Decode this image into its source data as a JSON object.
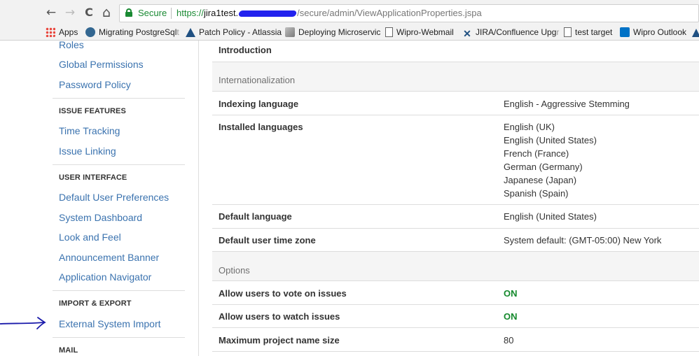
{
  "browser": {
    "nav": {
      "back": "←",
      "forward": "→",
      "reload": "C",
      "home": "⌂"
    },
    "secure_label": "Secure",
    "url_scheme": "https://",
    "url_host": "jira1test.",
    "url_path": "/secure/admin/ViewApplicationProperties.jspa",
    "bookmarks": [
      {
        "label": "Apps",
        "icon": "apps-grid-icon",
        "color": "#e8453c"
      },
      {
        "label": "Migrating PostgreSql",
        "fade": "t",
        "icon": "elephant-icon",
        "color": "#336791"
      },
      {
        "label": "Patch Policy - Atlassia",
        "icon": "atlassian-icon",
        "color": "#205081"
      },
      {
        "label": "Deploying Microservic",
        "icon": "deploy-icon",
        "color": "#8a8a8a"
      },
      {
        "label": "Wipro-Webmail",
        "icon": "page-icon",
        "color": "#ffffff"
      },
      {
        "label": "JIRA/Confluence Upg",
        "fade": "r",
        "icon": "jira-icon",
        "color": "#205081"
      },
      {
        "label": "test target",
        "icon": "page-icon",
        "color": "#ffffff"
      },
      {
        "label": "Wipro Outlook",
        "icon": "outlook-icon",
        "color": "#0072c6"
      }
    ]
  },
  "sidebar": {
    "items": [
      {
        "kind": "link",
        "label": "Roles"
      },
      {
        "kind": "link",
        "label": "Global Permissions"
      },
      {
        "kind": "link",
        "label": "Password Policy"
      },
      {
        "kind": "heading",
        "label": "ISSUE FEATURES"
      },
      {
        "kind": "link",
        "label": "Time Tracking"
      },
      {
        "kind": "link",
        "label": "Issue Linking"
      },
      {
        "kind": "heading",
        "label": "USER INTERFACE"
      },
      {
        "kind": "link",
        "label": "Default User Preferences"
      },
      {
        "kind": "link",
        "label": "System Dashboard"
      },
      {
        "kind": "link",
        "label": "Look and Feel"
      },
      {
        "kind": "link",
        "label": "Announcement Banner"
      },
      {
        "kind": "link",
        "label": "Application Navigator"
      },
      {
        "kind": "heading",
        "label": "IMPORT & EXPORT"
      },
      {
        "kind": "link",
        "label": "External System Import"
      },
      {
        "kind": "heading",
        "label": "MAIL"
      }
    ]
  },
  "main": {
    "introduction_label": "Introduction",
    "sections": {
      "internationalization": "Internationalization",
      "options": "Options"
    },
    "rows": {
      "indexing_language": {
        "label": "Indexing language",
        "value": "English - Aggressive Stemming"
      },
      "installed_languages": {
        "label": "Installed languages",
        "values": [
          "English (UK)",
          "English (United States)",
          "French (France)",
          "German (Germany)",
          "Japanese (Japan)",
          "Spanish (Spain)"
        ]
      },
      "default_language": {
        "label": "Default language",
        "value": "English (United States)"
      },
      "default_time_zone": {
        "label": "Default user time zone",
        "value": "System default: (GMT-05:00) New York"
      },
      "allow_vote": {
        "label": "Allow users to vote on issues",
        "value": "ON"
      },
      "allow_watch": {
        "label": "Allow users to watch issues",
        "value": "ON"
      },
      "max_project_name": {
        "label": "Maximum project name size",
        "value": "80"
      }
    }
  },
  "colors": {
    "link": "#3b73af",
    "secure_green": "#1a8a33",
    "on_green": "#14892c",
    "annotation_arrow": "#1a1aaa"
  }
}
